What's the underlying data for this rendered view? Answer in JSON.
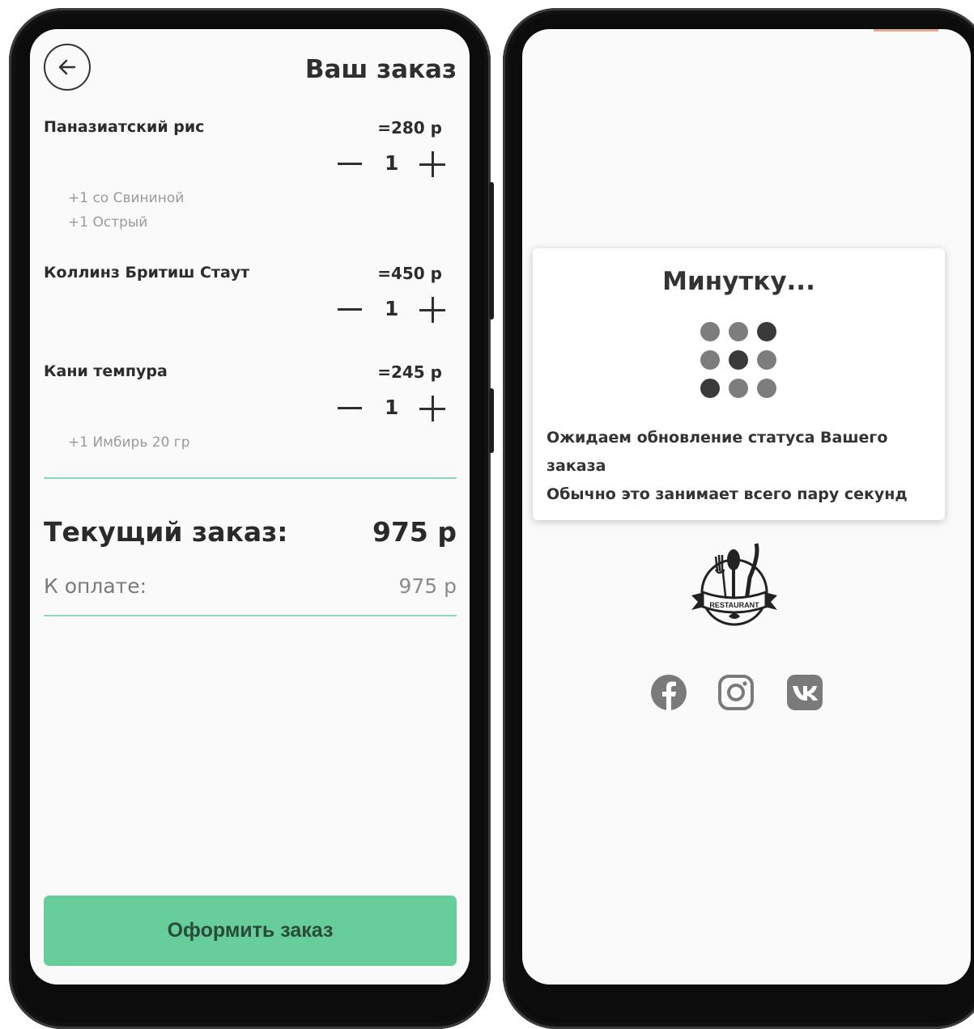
{
  "order_screen": {
    "title": "Ваш заказ",
    "items": [
      {
        "name": "Паназиатский рис",
        "price": "=280 р",
        "qty": "1",
        "modifiers": [
          "+1 со Свининой",
          "+1 Острый"
        ]
      },
      {
        "name": "Коллинз Бритиш Стаут",
        "price": "=450 р",
        "qty": "1",
        "modifiers": []
      },
      {
        "name": "Кани темпура",
        "price": "=245 р",
        "qty": "1",
        "modifiers": [
          "+1 Имбирь 20 гр"
        ]
      }
    ],
    "total_label": "Текущий заказ:",
    "total_value": "975 р",
    "pay_label": "К оплате:",
    "pay_value": "975 р",
    "checkout_label": "Оформить заказ",
    "colors": {
      "accent": "#66cc99",
      "divider": "#8fd6c0"
    }
  },
  "waiting_screen": {
    "title": "Минутку...",
    "line1": "Ожидаем обновление статуса Вашего",
    "line2": "заказа",
    "line3": "Обычно это занимает всего пару секунд",
    "loader_icon": "dots-grid-loader-icon",
    "logo_text": "RESTAURANT",
    "socials": [
      "facebook-icon",
      "instagram-icon",
      "vk-icon"
    ]
  }
}
